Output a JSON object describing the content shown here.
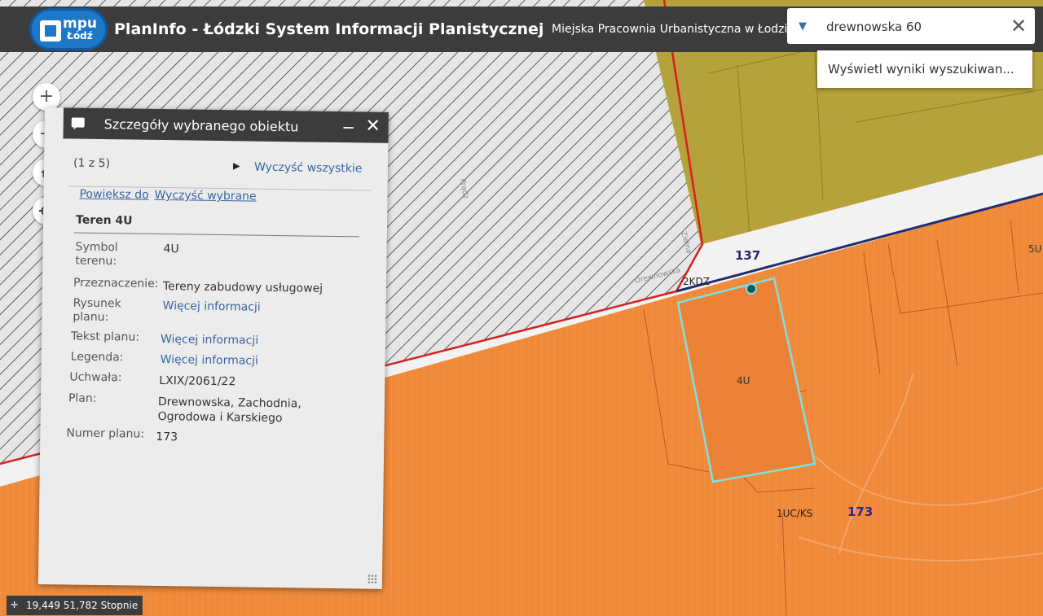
{
  "header": {
    "logo_line1": "mpu",
    "logo_line2": "Łódź",
    "title": "PlanInfo - Łódzki System Informacji Planistycznej",
    "organization": "Miejska Pracownia Urbanistyczna w Łodzi"
  },
  "search": {
    "value": "drewnowska 60",
    "suggestion": "Wyświetl wyniki wyszukiwan..."
  },
  "map_controls": {
    "zoom_in": "+",
    "zoom_out": "−"
  },
  "map_labels": {
    "street_drewnowska": "Drewnowska",
    "street_side": "Prądz",
    "street_side2": "Zielna",
    "road_code": "2KDZ",
    "plan_number_top": "137",
    "parcel_4u": "4U",
    "parcel_5u": "5U",
    "parcel_1uc": "1UC/KS",
    "plan_number_bottom": "173"
  },
  "panel": {
    "title": "Szczegóły wybranego obiektu",
    "counter": "(1 z 5)",
    "clear_all": "Wyczyść wszystkie",
    "zoom_to": "Powiększ do",
    "clear_selected": "Wyczyść wybrane",
    "feature_title": "Teren 4U",
    "fields": {
      "symbol_label": "Symbol terenu:",
      "symbol_value": "4U",
      "purpose_label": "Przeznaczenie:",
      "purpose_value": "Tereny zabudowy usługowej",
      "drawing_label": "Rysunek planu:",
      "drawing_value": "Więcej informacji",
      "text_label": "Tekst planu:",
      "text_value": "Więcej informacji",
      "legend_label": "Legenda:",
      "legend_value": "Więcej informacji",
      "resolution_label": "Uchwała:",
      "resolution_value": "LXIX/2061/22",
      "plan_label": "Plan:",
      "plan_value": "Drewnowska, Zachodnia, Ogrodowa i Karskiego",
      "plan_number_label": "Numer planu:",
      "plan_number_value": "173"
    }
  },
  "status": {
    "coordinates": "19,449 51,782 Stopnie"
  },
  "colors": {
    "header_bg": "#3c3c3c",
    "zone_orange": "#f08a3a",
    "zone_olive": "#b5a23a",
    "selection_outline": "#7fe0e0",
    "plan_boundary_red": "#d62020",
    "link_blue": "#3a64a0"
  }
}
